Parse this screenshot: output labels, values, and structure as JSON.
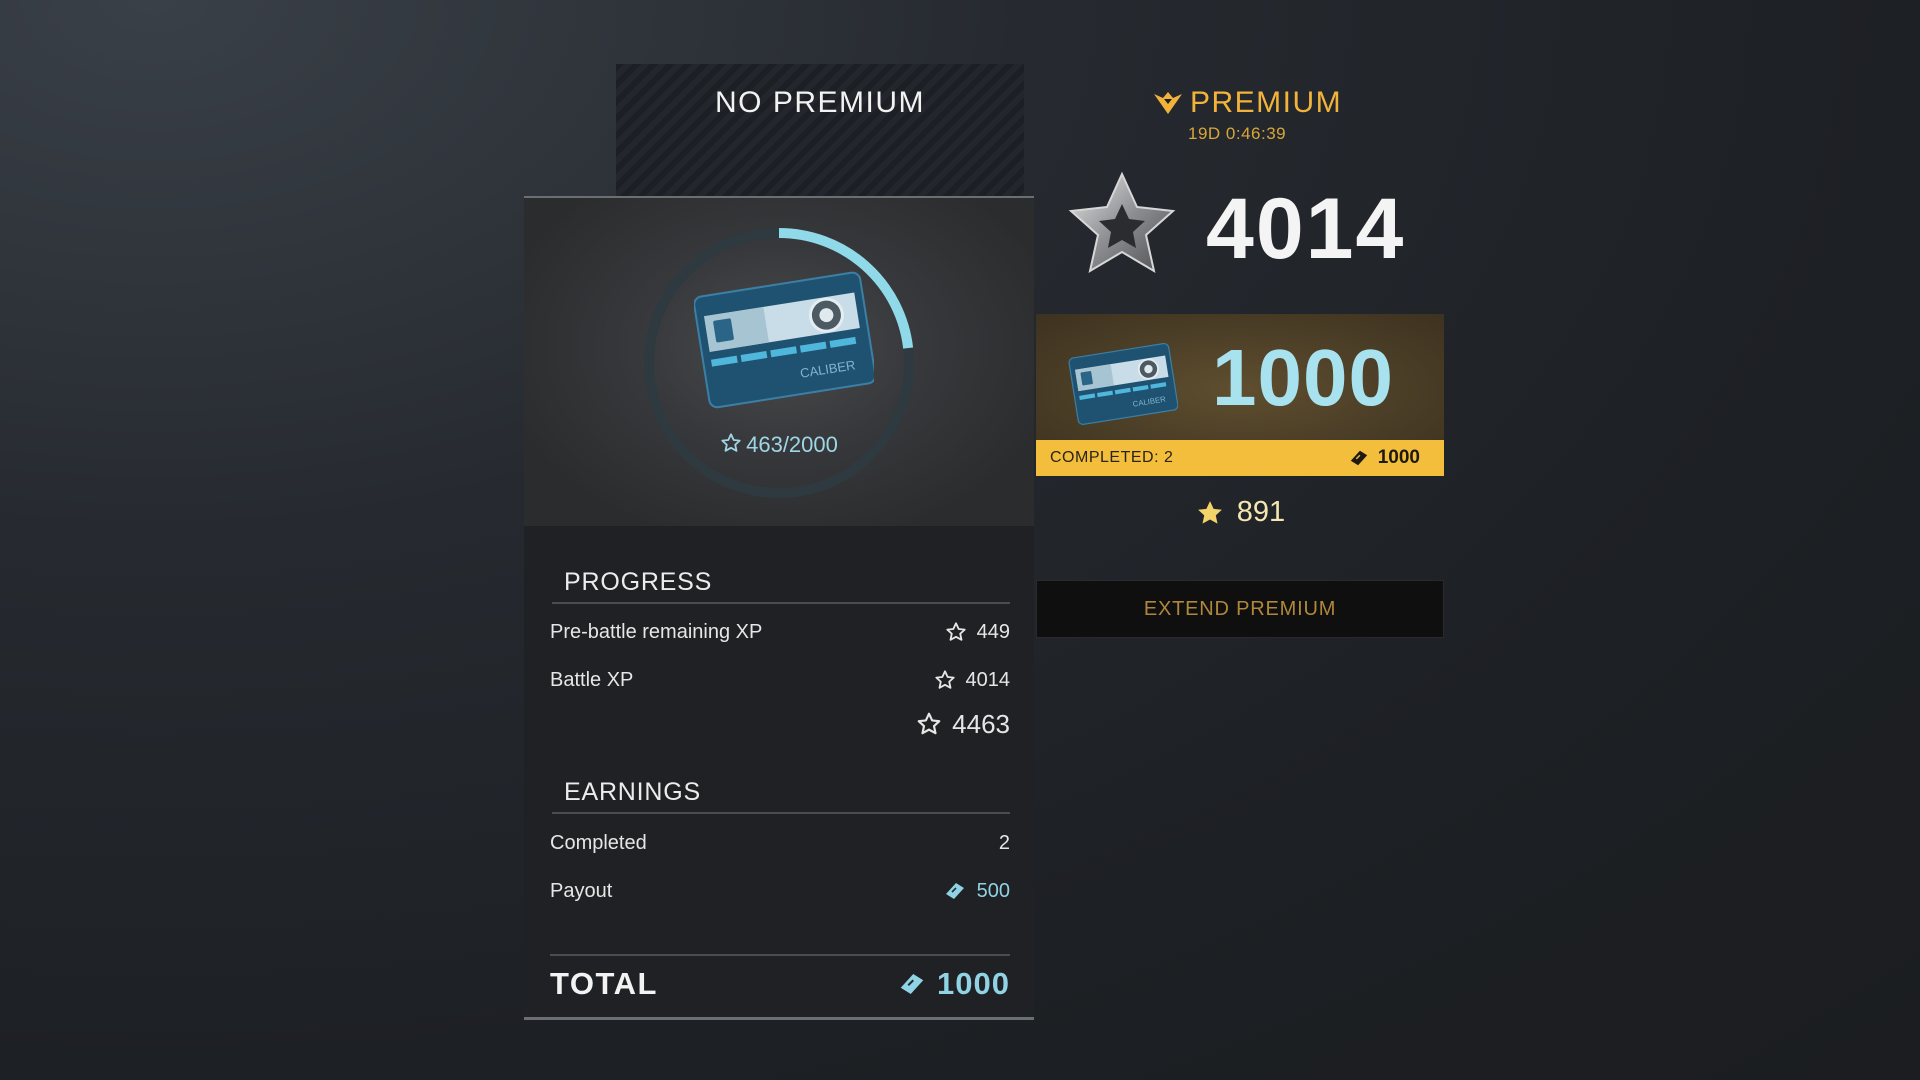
{
  "no_premium": {
    "title": "NO PREMIUM",
    "card_progress": {
      "current": 463,
      "max": 2000,
      "label": "463/2000",
      "fraction": 0.2315
    },
    "progress": {
      "title": "PROGRESS",
      "pre_battle_label": "Pre-battle remaining XP",
      "pre_battle_value": "449",
      "battle_xp_label": "Battle XP",
      "battle_xp_value": "4014",
      "sum_value": "4463"
    },
    "earnings": {
      "title": "EARNINGS",
      "completed_label": "Completed",
      "completed_value": "2",
      "payout_label": "Payout",
      "payout_value": "500"
    },
    "total": {
      "label": "TOTAL",
      "value": "1000"
    }
  },
  "premium": {
    "title": "PREMIUM",
    "timer": "19D 0:46:39",
    "xp": "4014",
    "reward_amount": "1000",
    "completed_text": "COMPLETED: 2",
    "completed_reward": "1000",
    "stars": "891",
    "extend_label": "EXTEND PREMIUM"
  },
  "colors": {
    "accent_gold": "#f2b33a",
    "accent_cyan": "#8fd3e4",
    "ring_progress": "#8fd9e8"
  },
  "icons": {
    "star": "star-outline-icon",
    "currency": "token-icon",
    "premium": "premium-wings-icon"
  },
  "card_text": "CALIBER"
}
